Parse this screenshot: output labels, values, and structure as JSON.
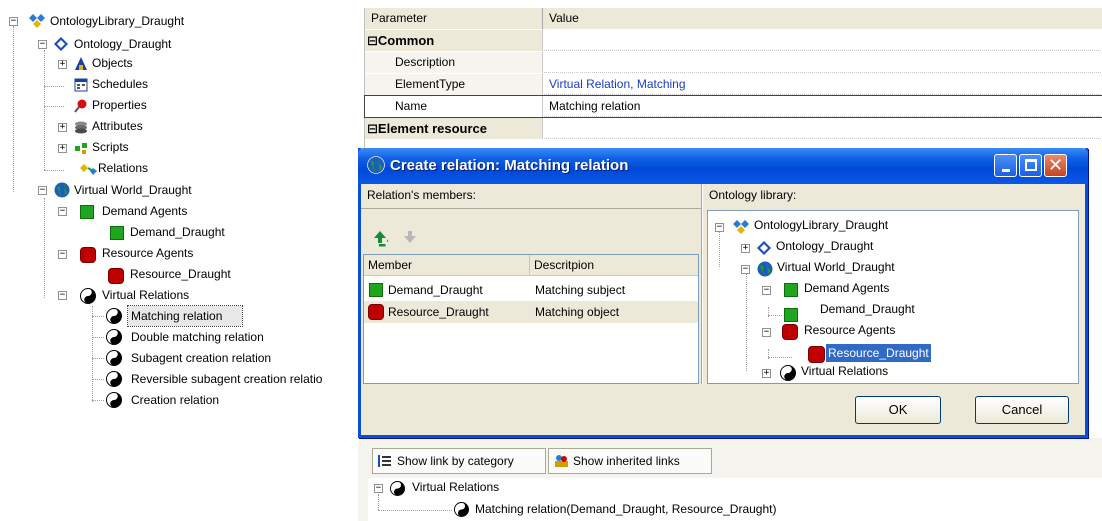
{
  "left_tree": {
    "root": "OntologyLibrary_Draught",
    "ontology": "Ontology_Draught",
    "objects": "Objects",
    "schedules": "Schedules",
    "properties": "Properties",
    "attributes": "Attributes",
    "scripts": "Scripts",
    "relations": "Relations",
    "virtual_world": "Virtual World_Draught",
    "demand_agents": "Demand Agents",
    "demand_draught": "Demand_Draught",
    "resource_agents": "Resource Agents",
    "resource_draught": "Resource_Draught",
    "virtual_relations": "Virtual Relations",
    "vr_items": [
      "Matching relation",
      "Double matching relation",
      "Subagent creation relation",
      "Reversible subagent creation relatio",
      "Creation relation"
    ]
  },
  "prop_grid": {
    "hdr_param": "Parameter",
    "hdr_value": "Value",
    "cat_common": "Common",
    "description": "Description",
    "element_type": "ElementType",
    "element_type_val": "Virtual Relation, Matching",
    "name": "Name",
    "name_val": "Matching relation",
    "cat_resource": "Element resource",
    "expander": "⊟"
  },
  "dialog": {
    "title": "Create relation: Matching relation",
    "members_label": "Relation's members:",
    "library_label": "Ontology library:",
    "col_member": "Member",
    "col_description": "Descritpion",
    "rows": [
      {
        "member": "Demand_Draught",
        "desc": "Matching subject"
      },
      {
        "member": "Resource_Draught",
        "desc": "Matching object"
      }
    ],
    "lib_root": "OntologyLibrary_Draught",
    "lib_ontology": "Ontology_Draught",
    "lib_virtual_world": "Virtual World_Draught",
    "lib_demand_agents": "Demand Agents",
    "lib_demand_draught": "Demand_Draught",
    "lib_resource_agents": "Resource Agents",
    "lib_resource_draught": "Resource_Draught",
    "lib_virtual_relations": "Virtual Relations",
    "ok": "OK",
    "cancel": "Cancel"
  },
  "bottom": {
    "tab1": "Show link by category",
    "tab2": "Show inherited links",
    "vr": "Virtual Relations",
    "link": "Matching relation(Demand_Draught, Resource_Draught)"
  },
  "colors": {
    "title_blue": "#0048d8",
    "green": "#1fa51f",
    "red": "#c00000",
    "select_blue": "#316ac5"
  },
  "icons": [
    "library-icon",
    "ontology-icon",
    "objects-icon",
    "schedules-icon",
    "properties-icon",
    "attributes-icon",
    "scripts-icon",
    "relations-icon",
    "globe-icon",
    "green-square-icon",
    "red-octagon-icon",
    "yin-yang-icon",
    "arrow-up-icon",
    "arrow-down-icon"
  ]
}
